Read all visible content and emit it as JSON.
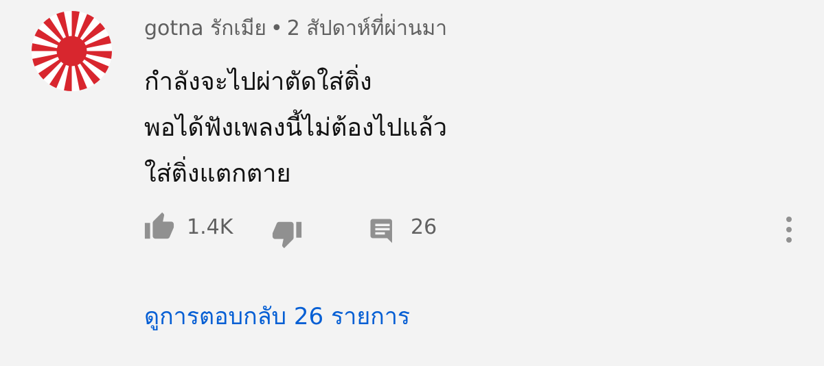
{
  "comment": {
    "author": "gotna รักเมีย",
    "separator": "•",
    "timestamp": "2 สัปดาห์ที่ผ่านมา",
    "lines": [
      "กำลังจะไปผ่าตัดใส่ติ่ง",
      "พอได้ฟังเพลงนี้ไม่ต้องไปแล้ว",
      "ใส่ติ่งแตกตาย"
    ],
    "avatar_colors": {
      "primary": "#d8262e",
      "secondary": "#ffffff"
    }
  },
  "actions": {
    "like_icon": "thumbs-up-icon",
    "like_count": "1.4K",
    "dislike_icon": "thumbs-down-icon",
    "reply_icon": "comment-icon",
    "reply_count": "26",
    "more_icon": "more-vertical-icon"
  },
  "view_replies": {
    "label": "ดูการตอบกลับ 26 รายการ"
  },
  "colors": {
    "background": "#f3f3f3",
    "link": "#065fd4",
    "muted": "#606060",
    "icon": "#909090"
  }
}
